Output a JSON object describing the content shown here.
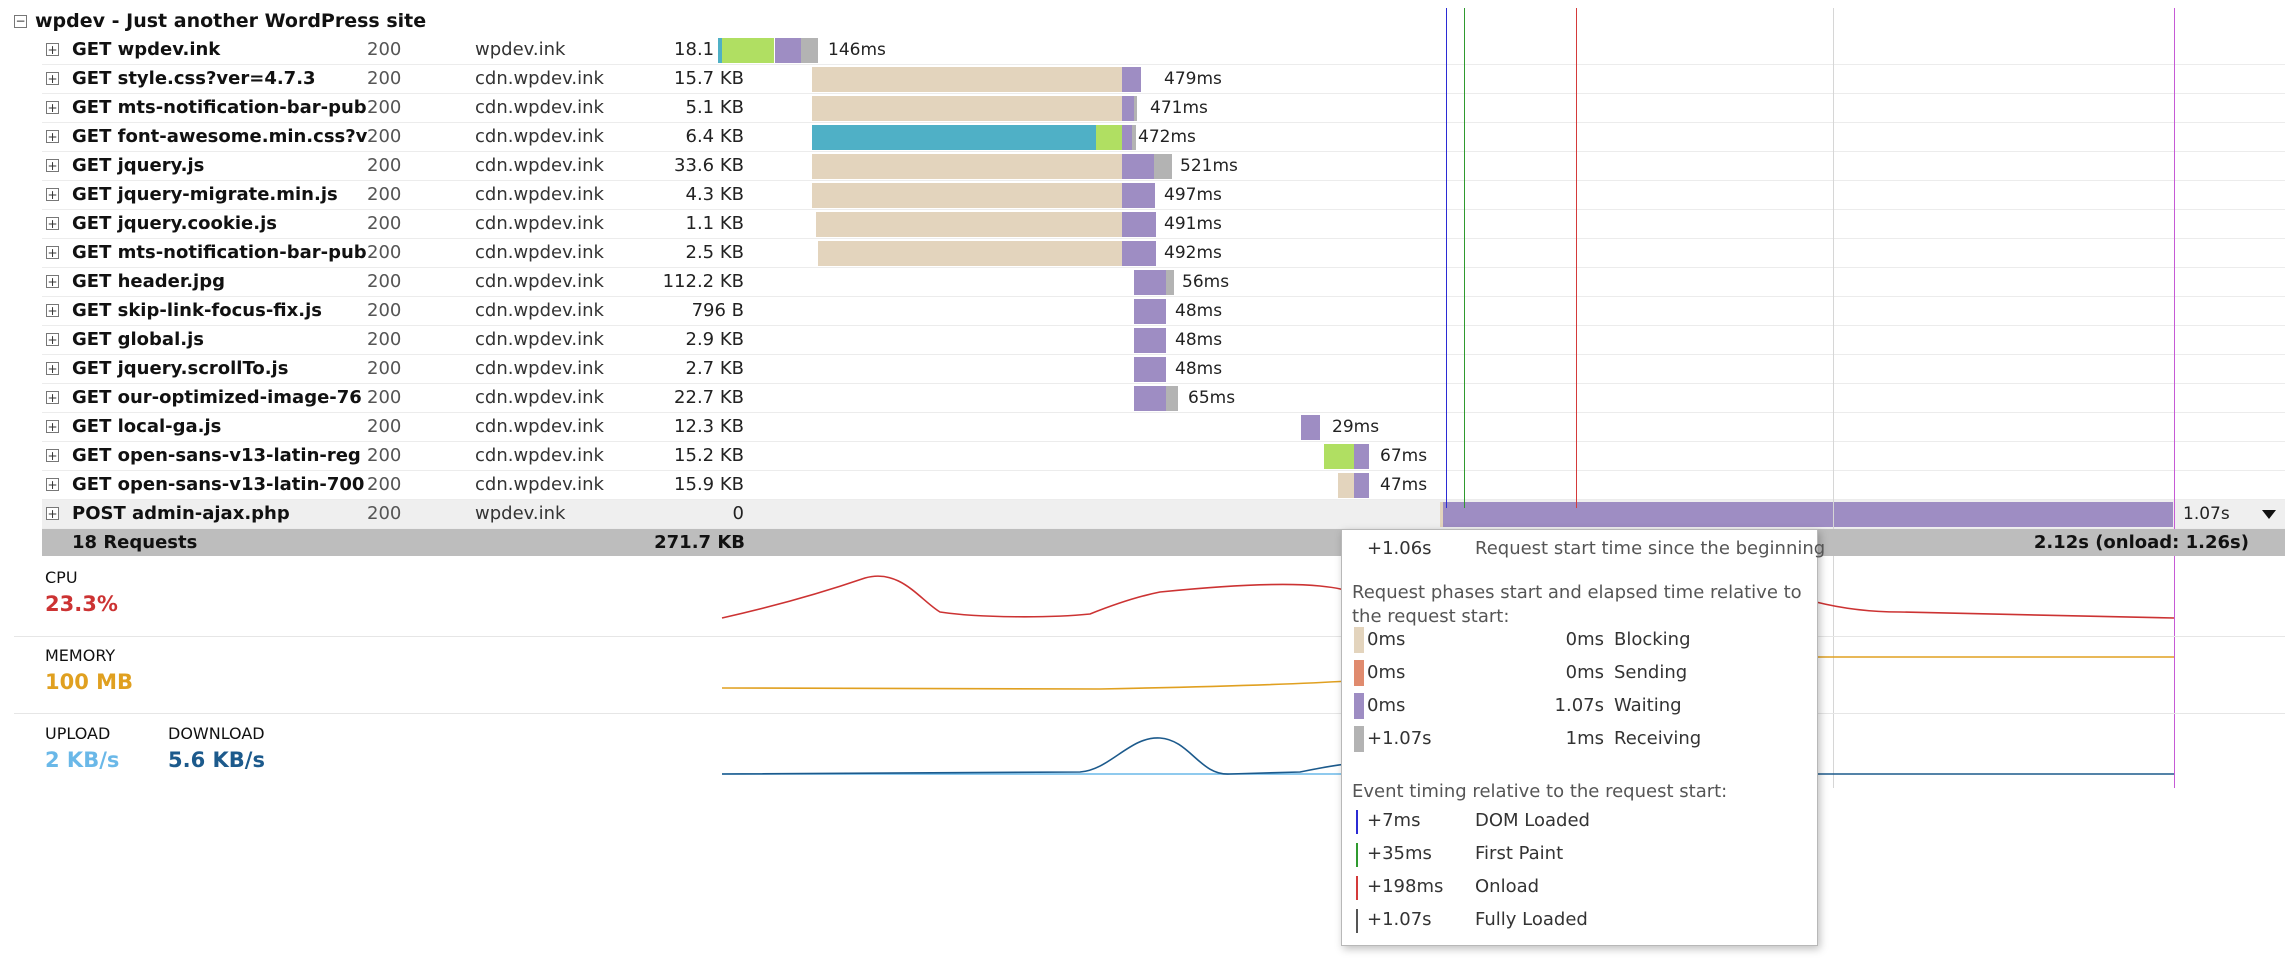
{
  "site": {
    "title": "wpdev - Just another WordPress site"
  },
  "requests": [
    {
      "name": "GET wpdev.ink",
      "status": "200",
      "domain": "wpdev.ink",
      "size": "18.1 KB",
      "time": "146ms"
    },
    {
      "name": "GET style.css?ver=4.7.3",
      "status": "200",
      "domain": "cdn.wpdev.ink",
      "size": "15.7 KB",
      "time": "479ms"
    },
    {
      "name": "GET mts-notification-bar-pub",
      "status": "200",
      "domain": "cdn.wpdev.ink",
      "size": "5.1 KB",
      "time": "471ms"
    },
    {
      "name": "GET font-awesome.min.css?v",
      "status": "200",
      "domain": "cdn.wpdev.ink",
      "size": "6.4 KB",
      "time": "472ms"
    },
    {
      "name": "GET jquery.js",
      "status": "200",
      "domain": "cdn.wpdev.ink",
      "size": "33.6 KB",
      "time": "521ms"
    },
    {
      "name": "GET jquery-migrate.min.js",
      "status": "200",
      "domain": "cdn.wpdev.ink",
      "size": "4.3 KB",
      "time": "497ms"
    },
    {
      "name": "GET jquery.cookie.js",
      "status": "200",
      "domain": "cdn.wpdev.ink",
      "size": "1.1 KB",
      "time": "491ms"
    },
    {
      "name": "GET mts-notification-bar-pub",
      "status": "200",
      "domain": "cdn.wpdev.ink",
      "size": "2.5 KB",
      "time": "492ms"
    },
    {
      "name": "GET header.jpg",
      "status": "200",
      "domain": "cdn.wpdev.ink",
      "size": "112.2 KB",
      "time": "56ms"
    },
    {
      "name": "GET skip-link-focus-fix.js",
      "status": "200",
      "domain": "cdn.wpdev.ink",
      "size": "796 B",
      "time": "48ms"
    },
    {
      "name": "GET global.js",
      "status": "200",
      "domain": "cdn.wpdev.ink",
      "size": "2.9 KB",
      "time": "48ms"
    },
    {
      "name": "GET jquery.scrollTo.js",
      "status": "200",
      "domain": "cdn.wpdev.ink",
      "size": "2.7 KB",
      "time": "48ms"
    },
    {
      "name": "GET our-optimized-image-76",
      "status": "200",
      "domain": "cdn.wpdev.ink",
      "size": "22.7 KB",
      "time": "65ms"
    },
    {
      "name": "GET local-ga.js",
      "status": "200",
      "domain": "cdn.wpdev.ink",
      "size": "12.3 KB",
      "time": "29ms"
    },
    {
      "name": "GET open-sans-v13-latin-reg",
      "status": "200",
      "domain": "cdn.wpdev.ink",
      "size": "15.2 KB",
      "time": "67ms"
    },
    {
      "name": "GET open-sans-v13-latin-700",
      "status": "200",
      "domain": "cdn.wpdev.ink",
      "size": "15.9 KB",
      "time": "47ms"
    },
    {
      "name": "POST admin-ajax.php",
      "status": "200",
      "domain": "wpdev.ink",
      "size": "0",
      "time": "1.07s"
    }
  ],
  "summary": {
    "requests": "18 Requests",
    "size": "271.7 KB",
    "total": "2.12s (onload: 1.26s)"
  },
  "metrics": {
    "cpu": {
      "label": "CPU",
      "value": "23.3%"
    },
    "memory": {
      "label": "MEMORY",
      "value": "100 MB"
    },
    "upload": {
      "label": "UPLOAD",
      "value": "2 KB/s"
    },
    "download": {
      "label": "DOWNLOAD",
      "value": "5.6 KB/s"
    }
  },
  "tooltip": {
    "start_value": "+1.06s",
    "start_label": "Request start time since the beginning",
    "phases_title": "Request phases start and elapsed time relative to the request start:",
    "phases": [
      {
        "start": "0ms",
        "elapsed": "0ms",
        "label": "Blocking",
        "color": "#e3d4bd"
      },
      {
        "start": "0ms",
        "elapsed": "0ms",
        "label": "Sending",
        "color": "#e08b6e"
      },
      {
        "start": "0ms",
        "elapsed": "1.07s",
        "label": "Waiting",
        "color": "#9e8dc3"
      },
      {
        "start": "+1.07s",
        "elapsed": "1ms",
        "label": "Receiving",
        "color": "#b3b3b3"
      }
    ],
    "events_title": "Event timing relative to the request start:",
    "events": [
      {
        "time": "+7ms",
        "label": "DOM Loaded",
        "color": "#2b2bd4"
      },
      {
        "time": "+35ms",
        "label": "First Paint",
        "color": "#2f9a2f"
      },
      {
        "time": "+198ms",
        "label": "Onload",
        "color": "#d43a3a"
      },
      {
        "time": "+1.07s",
        "label": "Fully Loaded",
        "color": "#555555"
      }
    ]
  },
  "colors": {
    "blocking": "#e3d4bd",
    "dns": "#4fb0c6",
    "connect": "#b0df62",
    "waiting": "#9e8dc3",
    "receiving": "#b3b3b3",
    "dom_loaded": "#2b2bd4",
    "first_paint": "#2f9a2f",
    "onload": "#d43a3a",
    "fully_loaded": "#c65ad6",
    "cpu": "#cc3333",
    "memory": "#e0a020",
    "upload": "#6ab8e8",
    "download": "#1c5a8c"
  },
  "icons": {
    "collapse": "minus-box-icon",
    "expand": "plus-box-icon",
    "dropdown": "caret-down-icon"
  }
}
